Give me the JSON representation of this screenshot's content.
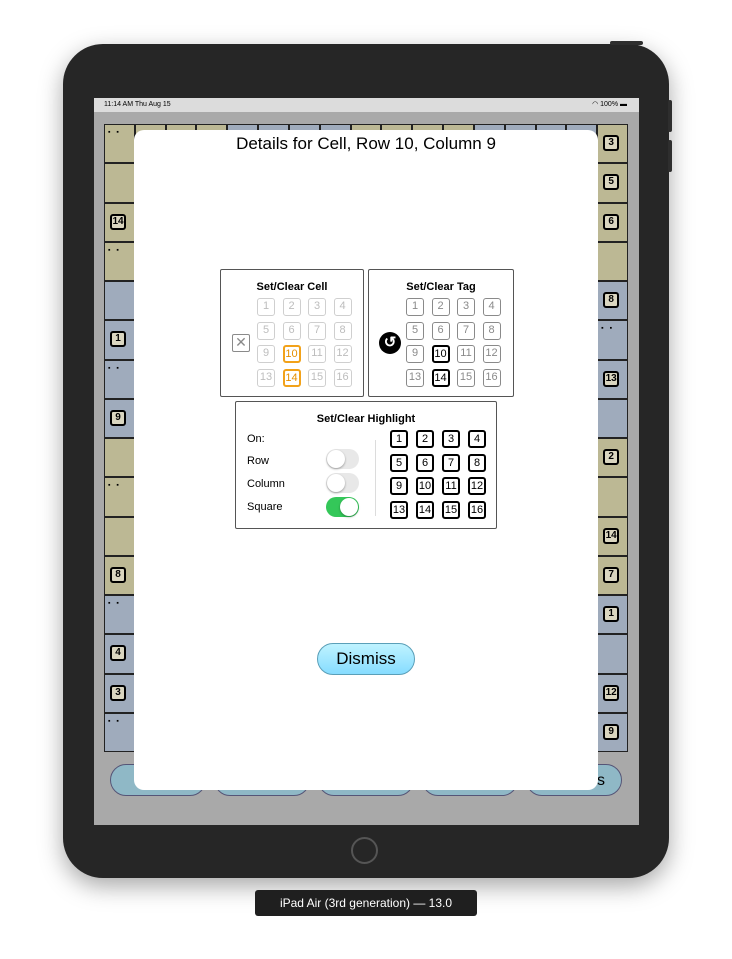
{
  "status_bar": {
    "time": "11:14 AM  Thu Aug 15",
    "battery": "100%"
  },
  "modal": {
    "title": "Details for Cell, Row 10, Column 9",
    "set_clear_cell": {
      "title": "Set/Clear Cell",
      "clear_icon": "x-icon",
      "numbers": [
        "1",
        "2",
        "3",
        "4",
        "5",
        "6",
        "7",
        "8",
        "9",
        "10",
        "11",
        "12",
        "13",
        "14",
        "15",
        "16"
      ],
      "states": [
        "faint",
        "faint",
        "faint",
        "faint",
        "faint",
        "faint",
        "faint",
        "faint",
        "faint",
        "orange",
        "faint",
        "faint",
        "faint",
        "orange",
        "faint",
        "faint"
      ]
    },
    "set_clear_tag": {
      "title": "Set/Clear Tag",
      "reset_icon": "undo-icon",
      "numbers": [
        "1",
        "2",
        "3",
        "4",
        "5",
        "6",
        "7",
        "8",
        "9",
        "10",
        "11",
        "12",
        "13",
        "14",
        "15",
        "16"
      ],
      "states": [
        "mid",
        "mid",
        "mid",
        "mid",
        "mid",
        "mid",
        "mid",
        "mid",
        "mid",
        "black",
        "mid",
        "mid",
        "mid",
        "black",
        "mid",
        "mid"
      ]
    },
    "set_clear_highlight": {
      "title": "Set/Clear Highlight",
      "on_label": "On:",
      "toggles": [
        {
          "label": "Row",
          "on": false
        },
        {
          "label": "Column",
          "on": false
        },
        {
          "label": "Square",
          "on": true
        }
      ],
      "numbers": [
        "1",
        "2",
        "3",
        "4",
        "5",
        "6",
        "7",
        "8",
        "9",
        "10",
        "11",
        "12",
        "13",
        "14",
        "15",
        "16"
      ]
    },
    "dismiss_label": "Dismiss"
  },
  "background_board": {
    "right_column_numbers": [
      "3",
      "5",
      "6",
      "",
      "8",
      "",
      "13",
      "",
      "2",
      "",
      "14",
      "7",
      "1",
      "",
      "12",
      "9"
    ],
    "left_column_numbers": [
      "",
      "",
      "14",
      "",
      "",
      "1",
      "",
      "9",
      "",
      "",
      "",
      "8",
      "",
      "4",
      "3",
      ""
    ],
    "bottom_partial_label": "s"
  },
  "caption": "iPad Air (3rd generation) — 13.0",
  "colors": {
    "orange": "#f2a21a",
    "toggle_on": "#34c759",
    "dismiss": "#86dcff",
    "tan": "#bcb894",
    "blue": "#9fabbc"
  }
}
